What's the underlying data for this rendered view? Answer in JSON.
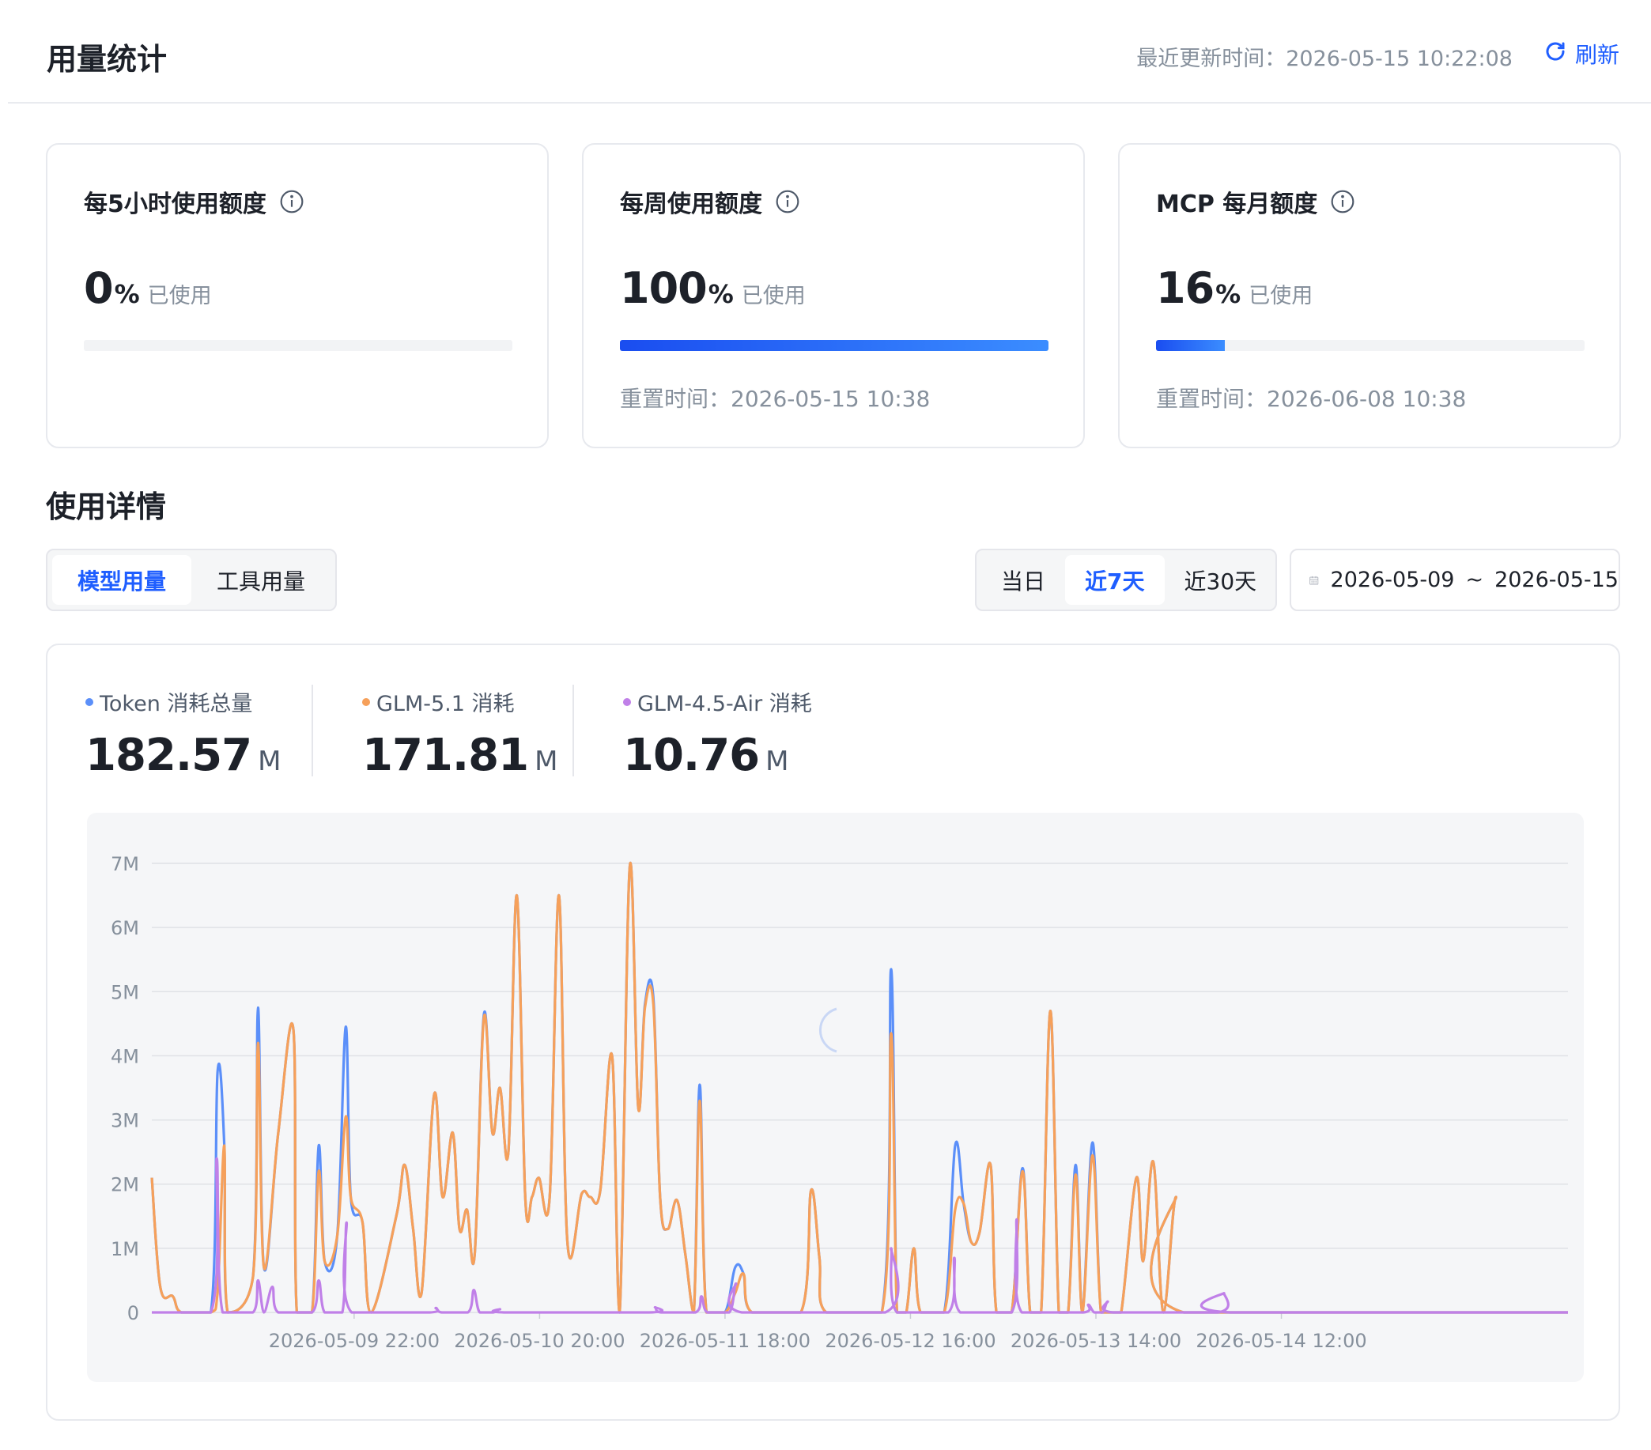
{
  "header": {
    "title": "用量统计",
    "last_update": "最近更新时间：2026-05-15 10:22:08",
    "refresh_label": "刷新"
  },
  "quota_cards": [
    {
      "title": "每5小时使用额度",
      "value": "0",
      "percent_sign": "%",
      "used_label": "已使用",
      "progress": 0,
      "reset": ""
    },
    {
      "title": "每周使用额度",
      "value": "100",
      "percent_sign": "%",
      "used_label": "已使用",
      "progress": 100,
      "reset": "重置时间：2026-05-15 10:38"
    },
    {
      "title": "MCP 每月额度",
      "value": "16",
      "percent_sign": "%",
      "used_label": "已使用",
      "progress": 16,
      "reset": "重置时间：2026-06-08 10:38"
    }
  ],
  "details": {
    "title": "使用详情",
    "tabs": [
      "模型用量",
      "工具用量"
    ],
    "active_tab": 0,
    "ranges": [
      "当日",
      "近7天",
      "近30天"
    ],
    "active_range": 1,
    "date_start": "2026-05-09",
    "date_sep": "~",
    "date_end": "2026-05-15"
  },
  "stats": [
    {
      "label": "Token 消耗总量",
      "value": "182.57",
      "unit": "M",
      "color": "#5b8ff9"
    },
    {
      "label": "GLM-5.1 消耗",
      "value": "171.81",
      "unit": "M",
      "color": "#f6a05a"
    },
    {
      "label": "GLM-4.5-Air 消耗",
      "value": "10.76",
      "unit": "M",
      "color": "#c080e8"
    }
  ],
  "colors": {
    "accent": "#1f5eff",
    "token": "#5b8ff9",
    "glm51": "#f6a05a",
    "glm45": "#c080e8"
  },
  "chart_data": {
    "type": "line",
    "yticks": [
      "0",
      "1M",
      "2M",
      "3M",
      "4M",
      "5M",
      "6M",
      "7M"
    ],
    "ylim": [
      0,
      7
    ],
    "yunit": "M",
    "xlim": [
      0,
      168
    ],
    "xticks": [
      {
        "x": 24,
        "label": "2026-05-09 22:00"
      },
      {
        "x": 46,
        "label": "2026-05-10 20:00"
      },
      {
        "x": 68,
        "label": "2026-05-11 18:00"
      },
      {
        "x": 90,
        "label": "2026-05-12 16:00"
      },
      {
        "x": 112,
        "label": "2026-05-13 14:00"
      },
      {
        "x": 134,
        "label": "2026-05-14 12:00"
      }
    ],
    "series": [
      {
        "name": "Token 消耗总量",
        "color": "#5b8ff9",
        "points": [
          [
            0,
            2.1
          ],
          [
            1,
            0.4
          ],
          [
            2.5,
            0.25
          ],
          [
            3.5,
            0
          ],
          [
            7,
            0
          ],
          [
            7.8,
            3.75
          ],
          [
            8.6,
            2.6
          ],
          [
            9,
            0
          ],
          [
            12,
            0.55
          ],
          [
            12.6,
            4.75
          ],
          [
            13.3,
            0.7
          ],
          [
            15,
            2.8
          ],
          [
            16.8,
            4.4
          ],
          [
            17.2,
            0
          ],
          [
            19,
            0
          ],
          [
            19.8,
            2.6
          ],
          [
            20.5,
            0.8
          ],
          [
            22,
            1.2
          ],
          [
            23,
            4.45
          ],
          [
            23.6,
            1.8
          ],
          [
            25,
            1.4
          ],
          [
            26,
            0
          ],
          [
            29,
            1.5
          ],
          [
            30,
            2.3
          ],
          [
            31,
            1.3
          ],
          [
            32,
            0.3
          ],
          [
            33.5,
            3.4
          ],
          [
            34.5,
            1.8
          ],
          [
            35.7,
            2.8
          ],
          [
            36.5,
            1.3
          ],
          [
            37.4,
            1.6
          ],
          [
            38.3,
            0.9
          ],
          [
            39.4,
            4.65
          ],
          [
            40.4,
            2.8
          ],
          [
            41.3,
            3.5
          ],
          [
            42.3,
            2.5
          ],
          [
            43.3,
            6.5
          ],
          [
            44.3,
            1.8
          ],
          [
            45.1,
            1.8
          ],
          [
            45.9,
            2.1
          ],
          [
            47.2,
            1.8
          ],
          [
            48.3,
            6.5
          ],
          [
            49.3,
            1.1
          ],
          [
            51,
            1.85
          ],
          [
            52,
            1.8
          ],
          [
            53.2,
            1.9
          ],
          [
            54.6,
            4
          ],
          [
            55.5,
            0
          ],
          [
            56.7,
            6.95
          ],
          [
            57.7,
            3.2
          ],
          [
            58.5,
            4.8
          ],
          [
            59.5,
            4.9
          ],
          [
            60.3,
            1.8
          ],
          [
            61.2,
            1.3
          ],
          [
            62.3,
            1.75
          ],
          [
            63.3,
            0.9
          ],
          [
            64.3,
            0
          ],
          [
            65,
            3.55
          ],
          [
            65.8,
            0
          ],
          [
            68,
            0
          ],
          [
            69.2,
            0.7
          ],
          [
            70.2,
            0.6
          ],
          [
            71.2,
            0
          ],
          [
            77,
            0
          ],
          [
            78.2,
            1.9
          ],
          [
            79.2,
            0.85
          ],
          [
            80,
            0
          ],
          [
            86.6,
            0
          ],
          [
            87.7,
            5.35
          ],
          [
            88.4,
            0
          ],
          [
            89.5,
            0
          ],
          [
            90.4,
            1
          ],
          [
            91.2,
            0
          ],
          [
            94,
            0
          ],
          [
            95.3,
            2.6
          ],
          [
            96.3,
            1.7
          ],
          [
            97.2,
            1.1
          ],
          [
            98.2,
            1.25
          ],
          [
            99.5,
            2.3
          ],
          [
            100.2,
            0
          ],
          [
            102,
            0
          ],
          [
            103.3,
            2.25
          ],
          [
            104.2,
            0
          ],
          [
            105.5,
            0
          ],
          [
            106.6,
            4.7
          ],
          [
            107.6,
            0
          ],
          [
            108.7,
            0
          ],
          [
            109.6,
            2.3
          ],
          [
            110.4,
            0
          ],
          [
            111.6,
            2.65
          ],
          [
            112.6,
            0
          ],
          [
            114,
            0
          ],
          [
            115,
            0
          ],
          [
            116.8,
            2.1
          ],
          [
            117.6,
            0.8
          ],
          [
            118.8,
            2.35
          ],
          [
            120,
            0
          ],
          [
            121.5,
            1.8
          ],
          [
            122.4,
            0
          ],
          [
            168,
            0
          ]
        ]
      },
      {
        "name": "GLM-5.1 消耗",
        "color": "#f6a05a",
        "points": [
          [
            0,
            2.1
          ],
          [
            1,
            0.4
          ],
          [
            2.5,
            0.25
          ],
          [
            3.5,
            0
          ],
          [
            7,
            0
          ],
          [
            7.8,
            0.3
          ],
          [
            8.6,
            2.6
          ],
          [
            9,
            0
          ],
          [
            12,
            0.55
          ],
          [
            12.6,
            4.2
          ],
          [
            13.3,
            0.7
          ],
          [
            15,
            2.8
          ],
          [
            16.8,
            4.4
          ],
          [
            17.2,
            0
          ],
          [
            19,
            0
          ],
          [
            19.8,
            2.2
          ],
          [
            20.5,
            0.8
          ],
          [
            22,
            1.2
          ],
          [
            23,
            3.05
          ],
          [
            23.6,
            1.8
          ],
          [
            25,
            1.4
          ],
          [
            26,
            0
          ],
          [
            29,
            1.5
          ],
          [
            30,
            2.3
          ],
          [
            31,
            1.3
          ],
          [
            32,
            0.3
          ],
          [
            33.5,
            3.4
          ],
          [
            34.5,
            1.8
          ],
          [
            35.7,
            2.8
          ],
          [
            36.5,
            1.3
          ],
          [
            37.4,
            1.6
          ],
          [
            38.3,
            0.9
          ],
          [
            39.4,
            4.6
          ],
          [
            40.4,
            2.8
          ],
          [
            41.3,
            3.5
          ],
          [
            42.3,
            2.5
          ],
          [
            43.3,
            6.5
          ],
          [
            44.3,
            1.8
          ],
          [
            45.1,
            1.8
          ],
          [
            45.9,
            2.1
          ],
          [
            47.2,
            1.8
          ],
          [
            48.3,
            6.5
          ],
          [
            49.3,
            1.1
          ],
          [
            51,
            1.85
          ],
          [
            52,
            1.8
          ],
          [
            53.2,
            1.9
          ],
          [
            54.6,
            4
          ],
          [
            55.5,
            0
          ],
          [
            56.7,
            6.95
          ],
          [
            57.7,
            3.2
          ],
          [
            58.5,
            4.75
          ],
          [
            59.5,
            4.8
          ],
          [
            60.3,
            1.8
          ],
          [
            61.2,
            1.3
          ],
          [
            62.3,
            1.75
          ],
          [
            63.3,
            0.9
          ],
          [
            64.3,
            0
          ],
          [
            65,
            3.3
          ],
          [
            65.8,
            0
          ],
          [
            68,
            0
          ],
          [
            69.2,
            0.3
          ],
          [
            70.2,
            0.6
          ],
          [
            71.2,
            0
          ],
          [
            77,
            0
          ],
          [
            78.2,
            1.9
          ],
          [
            79.2,
            0.85
          ],
          [
            80,
            0
          ],
          [
            86.6,
            0
          ],
          [
            87.7,
            4.35
          ],
          [
            88.4,
            0
          ],
          [
            89.5,
            0
          ],
          [
            90.4,
            1
          ],
          [
            91.2,
            0
          ],
          [
            94,
            0
          ],
          [
            95.3,
            1.6
          ],
          [
            96.3,
            1.7
          ],
          [
            97.2,
            1.1
          ],
          [
            98.2,
            1.25
          ],
          [
            99.5,
            2.3
          ],
          [
            100.2,
            0
          ],
          [
            102,
            0
          ],
          [
            103.3,
            2.2
          ],
          [
            104.2,
            0
          ],
          [
            105.5,
            0
          ],
          [
            106.6,
            4.7
          ],
          [
            107.6,
            0
          ],
          [
            108.7,
            0
          ],
          [
            109.6,
            2.15
          ],
          [
            110.4,
            0
          ],
          [
            111.6,
            2.45
          ],
          [
            112.6,
            0
          ],
          [
            114,
            0
          ],
          [
            115,
            0
          ],
          [
            116.8,
            2.1
          ],
          [
            117.6,
            0.8
          ],
          [
            118.8,
            2.35
          ],
          [
            120,
            0
          ],
          [
            121.5,
            1.8
          ],
          [
            122.4,
            0
          ],
          [
            168,
            0
          ]
        ]
      },
      {
        "name": "GLM-4.5-Air 消耗",
        "color": "#c080e8",
        "points": [
          [
            0,
            0
          ],
          [
            7,
            0
          ],
          [
            7.7,
            2.4
          ],
          [
            8.4,
            0
          ],
          [
            12,
            0
          ],
          [
            12.6,
            0.5
          ],
          [
            13.3,
            0
          ],
          [
            14.3,
            0.4
          ],
          [
            15,
            0
          ],
          [
            19,
            0
          ],
          [
            19.8,
            0.5
          ],
          [
            20.5,
            0
          ],
          [
            22.6,
            0
          ],
          [
            23.1,
            1.4
          ],
          [
            23.7,
            0
          ],
          [
            33,
            0
          ],
          [
            33.7,
            0.07
          ],
          [
            34.4,
            0
          ],
          [
            37.5,
            0
          ],
          [
            38.2,
            0.35
          ],
          [
            38.9,
            0
          ],
          [
            40.5,
            0
          ],
          [
            41.3,
            0.05
          ],
          [
            42,
            0
          ],
          [
            59,
            0
          ],
          [
            59.7,
            0.08
          ],
          [
            60.4,
            0
          ],
          [
            64.5,
            0
          ],
          [
            65.2,
            0.25
          ],
          [
            65.9,
            0
          ],
          [
            68.5,
            0
          ],
          [
            69.3,
            0.45
          ],
          [
            70,
            0
          ],
          [
            87,
            0
          ],
          [
            87.7,
            1
          ],
          [
            88.4,
            0
          ],
          [
            94.5,
            0
          ],
          [
            95.2,
            0.85
          ],
          [
            95.9,
            0
          ],
          [
            102,
            0
          ],
          [
            102.6,
            1.45
          ],
          [
            103.2,
            0
          ],
          [
            110.5,
            0
          ],
          [
            111.1,
            0.12
          ],
          [
            111.8,
            0
          ],
          [
            112.8,
            0
          ],
          [
            113.4,
            0.17
          ],
          [
            114,
            0
          ],
          [
            126.5,
            0
          ],
          [
            127.2,
            0.3
          ],
          [
            127.9,
            0
          ],
          [
            168,
            0
          ]
        ]
      }
    ]
  }
}
